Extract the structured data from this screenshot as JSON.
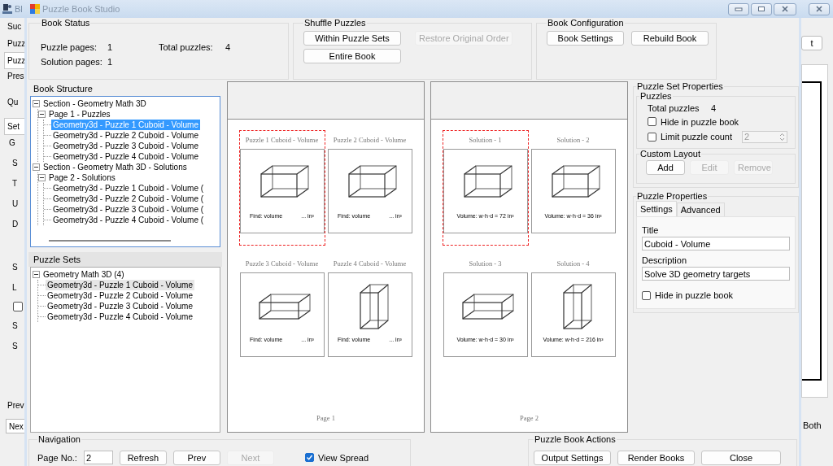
{
  "background_window": {
    "title": "Bl",
    "tabs": [
      {
        "label": "Suc",
        "selected": false
      },
      {
        "label": "Puzz",
        "selected": false
      },
      {
        "label": "Puzz",
        "selected": true
      }
    ],
    "labels": [
      "Pres",
      "Qu"
    ],
    "inner_tabs": [
      {
        "label": "Set",
        "selected": true
      }
    ],
    "group_title": "G",
    "fields": [
      "S",
      "T",
      "U",
      "D"
    ],
    "fields_2": [
      "S",
      "L"
    ],
    "checkbox": {
      "checked": false
    },
    "fields_3": [
      "S",
      "S"
    ],
    "nav_label": "Prev",
    "nav_button": "Nex",
    "side_button": "t",
    "side_label": "Both"
  },
  "window": {
    "title": "Puzzle Book Studio"
  },
  "book_status": {
    "title": "Book Status",
    "stats": [
      {
        "label": "Puzzle pages:",
        "value": "1"
      },
      {
        "label": "Solution pages:",
        "value": "1"
      },
      {
        "label": "Total puzzles:",
        "value": "4"
      }
    ]
  },
  "shuffle_puzzles": {
    "title": "Shuffle Puzzles",
    "buttons": [
      {
        "label": "Within Puzzle Sets",
        "disabled": false
      },
      {
        "label": "Restore Original Order",
        "disabled": true
      },
      {
        "label": "Entire Book",
        "disabled": false
      }
    ]
  },
  "book_configuration": {
    "title": "Book Configuration",
    "buttons": [
      {
        "label": "Book Settings",
        "disabled": false
      },
      {
        "label": "Rebuild Book",
        "disabled": false
      }
    ]
  },
  "book_structure": {
    "title": "Book Structure",
    "focused": true,
    "tree": [
      {
        "label": "Section - Geometry Math 3D",
        "expanded": true,
        "selected": false,
        "children": [
          {
            "label": "Page 1 - Puzzles",
            "expanded": true,
            "selected": false,
            "children": [
              {
                "label": "Geometry3d - Puzzle 1 Cuboid - Volume",
                "selected": true
              },
              {
                "label": "Geometry3d - Puzzle 2 Cuboid - Volume",
                "selected": false
              },
              {
                "label": "Geometry3d - Puzzle 3 Cuboid - Volume",
                "selected": false
              },
              {
                "label": "Geometry3d - Puzzle 4 Cuboid - Volume",
                "selected": false
              }
            ]
          }
        ]
      },
      {
        "label": "Section - Geometry Math 3D - Solutions",
        "expanded": true,
        "selected": false,
        "children": [
          {
            "label": "Page 2 - Solutions",
            "expanded": true,
            "selected": false,
            "children": [
              {
                "label": "Geometry3d - Puzzle 1 Cuboid - Volume (",
                "selected": false
              },
              {
                "label": "Geometry3d - Puzzle 2 Cuboid - Volume (",
                "selected": false
              },
              {
                "label": "Geometry3d - Puzzle 3 Cuboid - Volume (",
                "selected": false
              },
              {
                "label": "Geometry3d - Puzzle 4 Cuboid - Volume (",
                "selected": false
              }
            ]
          }
        ]
      }
    ]
  },
  "puzzle_sets": {
    "title": "Puzzle Sets",
    "focused": false,
    "tree": [
      {
        "label": "Geometry Math 3D (4)",
        "expanded": true,
        "selected": false,
        "children": [
          {
            "label": "Geometry3d - Puzzle 1 Cuboid - Volume",
            "selected": true
          },
          {
            "label": "Geometry3d - Puzzle 2 Cuboid - Volume",
            "selected": false
          },
          {
            "label": "Geometry3d - Puzzle 3 Cuboid - Volume",
            "selected": false
          },
          {
            "label": "Geometry3d - Puzzle 4 Cuboid - Volume",
            "selected": false
          }
        ]
      }
    ]
  },
  "pages": [
    {
      "label": "Page 1",
      "tiles": [
        {
          "title": "Puzzle 1 Cuboid - Volume",
          "kind": "wide",
          "selected": true,
          "footer": [
            "Find: volume",
            "... in³"
          ]
        },
        {
          "title": "Puzzle 2 Cuboid - Volume",
          "kind": "wide",
          "selected": false,
          "footer": [
            "Find: volume",
            "... in³"
          ]
        },
        {
          "title": "Puzzle 3 Cuboid - Volume",
          "kind": "flat",
          "selected": false,
          "footer": [
            "Find: volume",
            "... in³"
          ]
        },
        {
          "title": "Puzzle 4 Cuboid - Volume",
          "kind": "tall",
          "selected": false,
          "footer": [
            "Find: volume",
            "... in³"
          ]
        }
      ]
    },
    {
      "label": "Page 2",
      "tiles": [
        {
          "title": "Solution - 1",
          "kind": "wide",
          "selected": true,
          "footer": [
            "Volume: w·h·d = 72 in³"
          ]
        },
        {
          "title": "Solution - 2",
          "kind": "wide",
          "selected": false,
          "footer": [
            "Volume: w·h·d = 36 in³"
          ]
        },
        {
          "title": "Solution - 3",
          "kind": "flat",
          "selected": false,
          "footer": [
            "Volume: w·h·d = 30 in³"
          ]
        },
        {
          "title": "Solution - 4",
          "kind": "tall",
          "selected": false,
          "footer": [
            "Volume: w·h·d = 216 in³"
          ]
        }
      ]
    }
  ],
  "puzzle_set_properties": {
    "title": "Puzzle Set Properties",
    "puzzles": {
      "title": "Puzzles",
      "total_label": "Total puzzles",
      "total_value": "4",
      "hide": {
        "label": "Hide in puzzle book",
        "checked": false
      },
      "limit": {
        "label": "Limit puzzle count",
        "checked": false,
        "value": "2",
        "disabled": true
      }
    },
    "custom_layout": {
      "title": "Custom Layout",
      "buttons": [
        {
          "label": "Add",
          "disabled": false
        },
        {
          "label": "Edit",
          "disabled": true
        },
        {
          "label": "Remove",
          "disabled": true
        }
      ]
    }
  },
  "puzzle_properties": {
    "title": "Puzzle Properties",
    "tabs": [
      {
        "label": "Settings",
        "selected": true
      },
      {
        "label": "Advanced",
        "selected": false
      }
    ],
    "title_label": "Title",
    "title_value": "Cuboid - Volume",
    "description_label": "Description",
    "description_value": "Solve 3D geometry targets",
    "hide": {
      "label": "Hide in puzzle book",
      "checked": false
    }
  },
  "navigation": {
    "title": "Navigation",
    "page_label": "Page No.:",
    "page_value": "2",
    "buttons": [
      {
        "label": "Refresh",
        "disabled": false
      },
      {
        "label": "Prev",
        "disabled": false
      },
      {
        "label": "Next",
        "disabled": true
      }
    ],
    "view_spread": {
      "label": "View Spread",
      "checked": true
    }
  },
  "actions": {
    "title": "Puzzle Book Actions",
    "buttons": [
      {
        "label": "Output Settings",
        "disabled": false
      },
      {
        "label": "Render Books",
        "disabled": false
      },
      {
        "label": "Close",
        "disabled": false
      }
    ]
  }
}
